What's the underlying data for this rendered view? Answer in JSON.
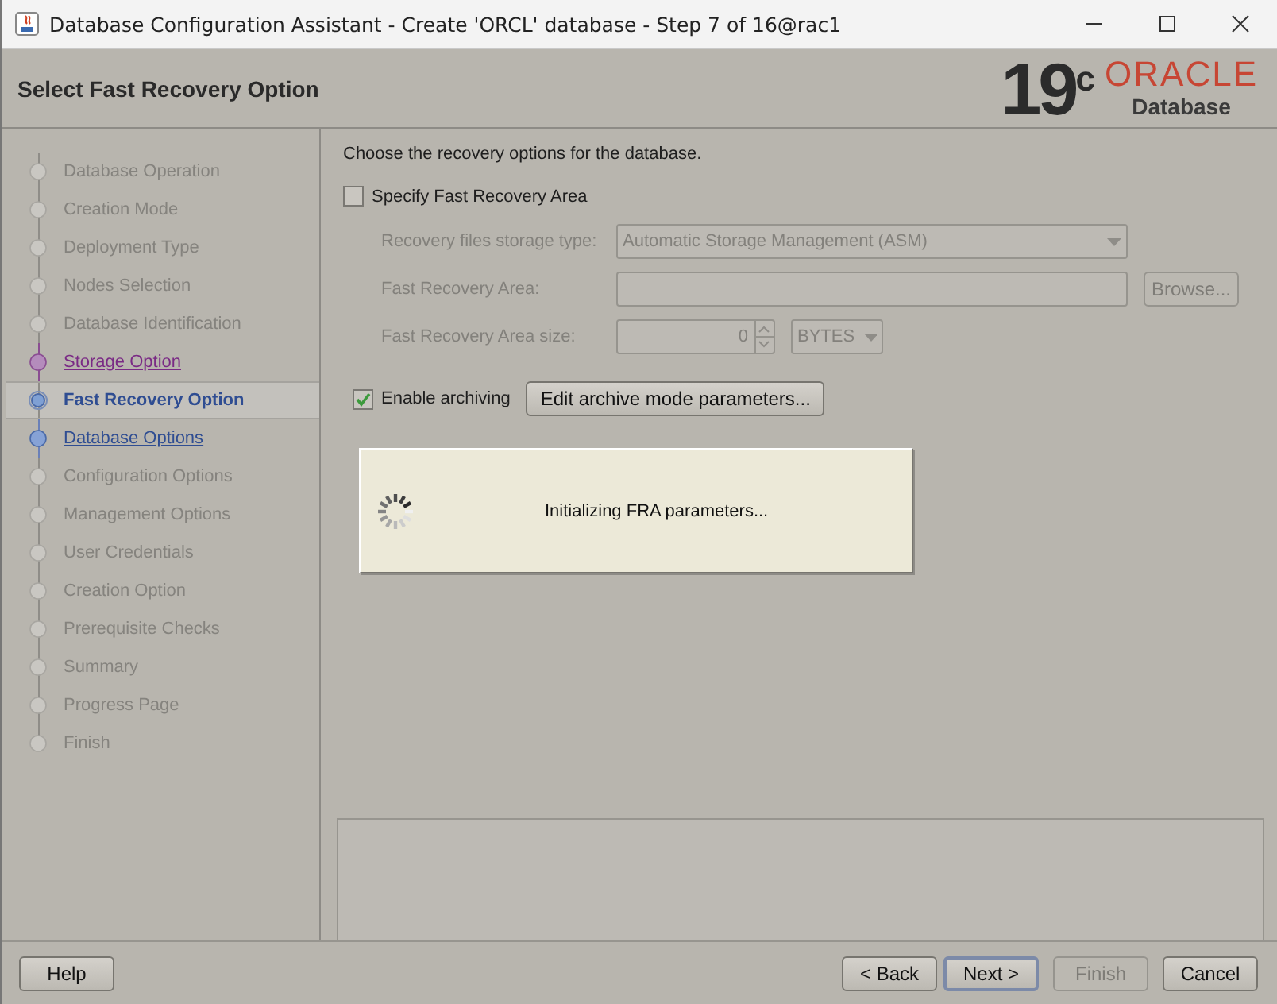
{
  "window": {
    "title": "Database Configuration Assistant - Create 'ORCL' database - Step 7 of 16@rac1"
  },
  "header": {
    "title": "Select Fast Recovery Option",
    "version": "19",
    "version_suffix": "c",
    "brand": "ORACLE",
    "product": "Database"
  },
  "steps": [
    {
      "label": "Database Operation",
      "disabled": true,
      "visited": false,
      "selected": false
    },
    {
      "label": "Creation Mode",
      "disabled": true,
      "visited": false,
      "selected": false
    },
    {
      "label": "Deployment Type",
      "disabled": true,
      "visited": false,
      "selected": false
    },
    {
      "label": "Nodes Selection",
      "disabled": true,
      "visited": false,
      "selected": false
    },
    {
      "label": "Database Identification",
      "disabled": true,
      "visited": false,
      "selected": false
    },
    {
      "label": "Storage Option",
      "disabled": false,
      "visited": true,
      "selected": false
    },
    {
      "label": "Fast Recovery Option",
      "disabled": false,
      "visited": false,
      "selected": true
    },
    {
      "label": "Database Options",
      "disabled": false,
      "visited": false,
      "selected": false
    },
    {
      "label": "Configuration Options",
      "disabled": true,
      "visited": false,
      "selected": false
    },
    {
      "label": "Management Options",
      "disabled": true,
      "visited": false,
      "selected": false
    },
    {
      "label": "User Credentials",
      "disabled": true,
      "visited": false,
      "selected": false
    },
    {
      "label": "Creation Option",
      "disabled": true,
      "visited": false,
      "selected": false
    },
    {
      "label": "Prerequisite Checks",
      "disabled": true,
      "visited": false,
      "selected": false
    },
    {
      "label": "Summary",
      "disabled": true,
      "visited": false,
      "selected": false
    },
    {
      "label": "Progress Page",
      "disabled": true,
      "visited": false,
      "selected": false
    },
    {
      "label": "Finish",
      "disabled": true,
      "visited": false,
      "selected": false
    }
  ],
  "content": {
    "intro": "Choose the recovery options for the database.",
    "specify_fra": {
      "label": "Specify Fast Recovery Area",
      "checked": false
    },
    "fields": [
      {
        "kind": "select",
        "label": "Recovery files storage type:",
        "value": "Automatic Storage Management (ASM)",
        "disabled": true
      },
      {
        "kind": "text",
        "label": "Fast Recovery Area:",
        "button": "Browse...",
        "disabled": true
      },
      {
        "kind": "spinner",
        "label": "Fast Recovery Area size:",
        "value": "0",
        "unit": "BYTES",
        "disabled": true
      }
    ],
    "archiving": {
      "label": "Enable archiving",
      "checked": true,
      "button": "Edit archive mode parameters..."
    },
    "progress": {
      "message": "Initializing FRA parameters..."
    }
  },
  "buttons": [
    {
      "label": "Help",
      "kind": "left",
      "disabled": false,
      "default": false
    },
    {
      "label": "< Back",
      "kind": "right",
      "disabled": false,
      "default": false
    },
    {
      "label": "Next >",
      "kind": "right",
      "disabled": false,
      "default": true
    },
    {
      "label": "Finish",
      "kind": "right",
      "disabled": true,
      "default": false
    },
    {
      "label": "Cancel",
      "kind": "right",
      "disabled": false,
      "default": false
    }
  ]
}
